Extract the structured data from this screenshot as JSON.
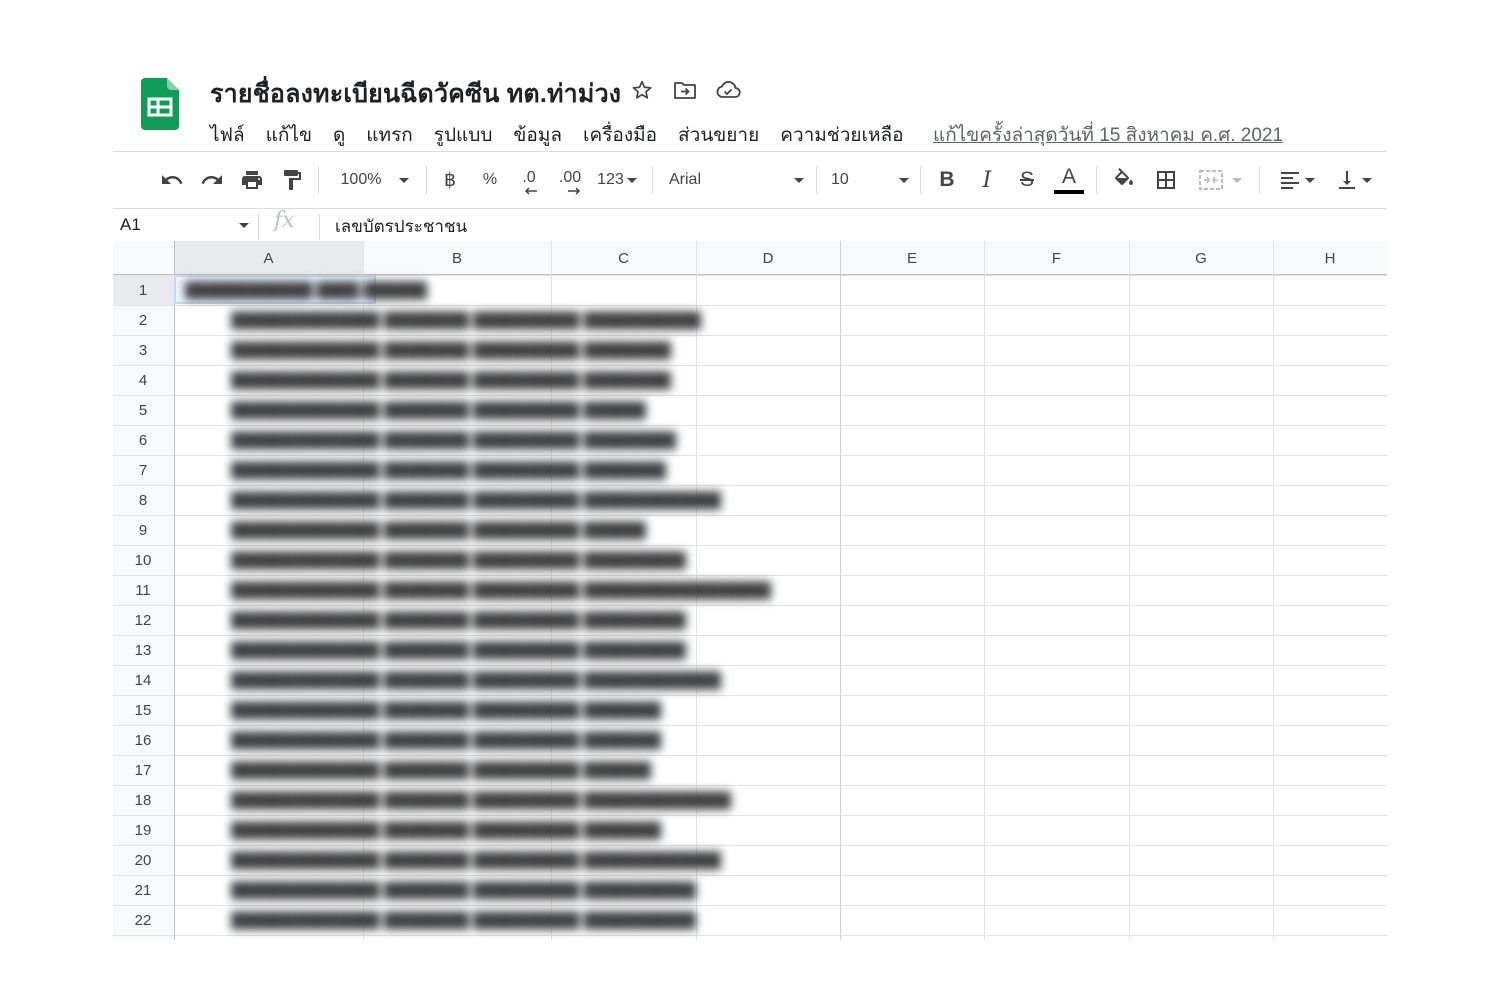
{
  "doc": {
    "title": "รายชื่อลงทะเบียนฉีดวัคซีน ทต.ท่าม่วง"
  },
  "menu": [
    "ไฟล์",
    "แก้ไข",
    "ดู",
    "แทรก",
    "รูปแบบ",
    "ข้อมูล",
    "เครื่องมือ",
    "ส่วนขยาย",
    "ความช่วยเหลือ"
  ],
  "last_edit": "แก้ไขครั้งล่าสุดวันที่ 15 สิงหาคม ค.ศ. 2021",
  "toolbar": {
    "zoom": "100%",
    "currency": "฿",
    "percent": "%",
    "dec_decrease": ".0",
    "dec_increase": ".00",
    "more_formats": "123",
    "font": "Arial",
    "font_size": "10",
    "bold": "B",
    "italic": "I",
    "strike": "S",
    "text_color_label": "A",
    "text_color": "#000000"
  },
  "formula_bar": {
    "cell_ref": "A1",
    "fx": "fx",
    "content": "เลขบัตรประชาชน"
  },
  "columns": [
    "A",
    "B",
    "C",
    "D",
    "E",
    "F",
    "G",
    "H"
  ],
  "rows": [
    "1",
    "2",
    "3",
    "4",
    "5",
    "6",
    "7",
    "8",
    "9",
    "10",
    "11",
    "12",
    "13",
    "14",
    "15",
    "16",
    "17",
    "18",
    "19",
    "20",
    "21",
    "22"
  ],
  "icons": [
    "sheets-logo-icon",
    "star-icon",
    "move-folder-icon",
    "cloud-status-icon",
    "undo-icon",
    "redo-icon",
    "print-icon",
    "paint-format-icon",
    "fill-color-icon",
    "borders-icon",
    "merge-cells-icon",
    "align-left-icon",
    "vertical-align-icon"
  ],
  "colors": {
    "logo_green": "#0f9d58",
    "grid_line": "#e2e3e3",
    "header_bg": "#f8f9fa",
    "selection": "#c6dafc"
  },
  "blurred_note": "cells A1–D22 contain blurred personal data"
}
